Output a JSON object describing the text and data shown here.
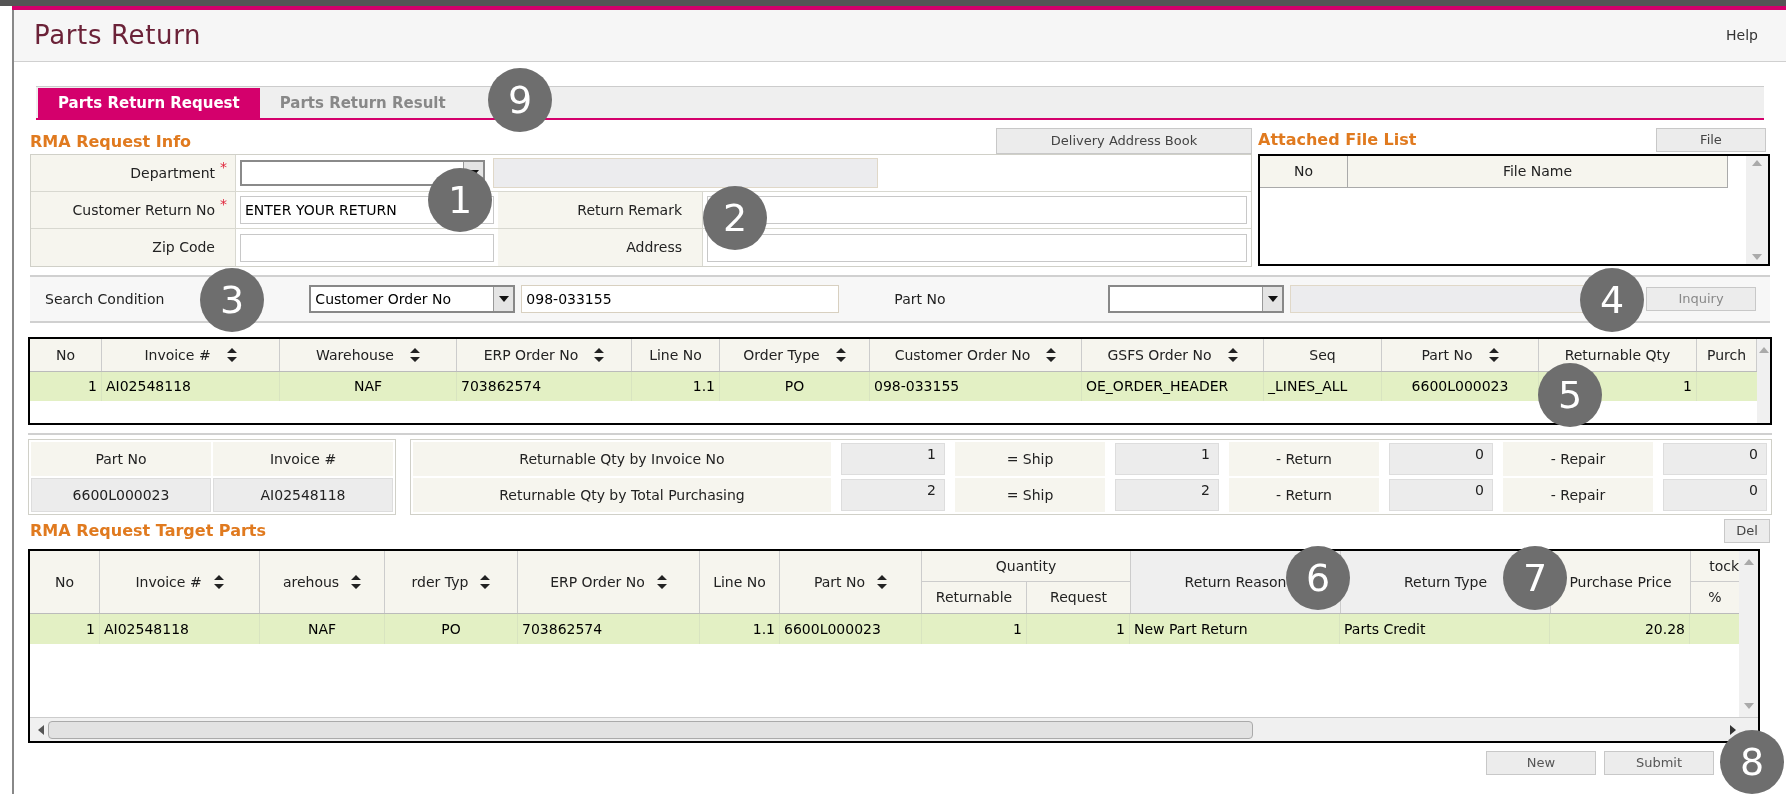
{
  "title": "Parts Return",
  "help": "Help",
  "tabs": [
    {
      "label": "Parts Return Request",
      "selected": true
    },
    {
      "label": "Parts Return Result",
      "selected": false
    }
  ],
  "request_info": {
    "heading": "RMA Request Info",
    "address_book_button": "Delivery Address Book",
    "rows": [
      [
        {
          "label": "Department",
          "marker": "*",
          "kind": "select"
        }
      ],
      [
        {
          "label": "Customer Return No",
          "marker": "*",
          "kind": "text",
          "value": "ENTER YOUR RETURN"
        },
        {
          "label": "Return Remark",
          "kind": "text"
        }
      ],
      [
        {
          "label": "Zip Code",
          "kind": "text"
        },
        {
          "label": "Address",
          "kind": "text"
        }
      ]
    ]
  },
  "attachments": {
    "heading": "Attached File List",
    "button": "File",
    "columns": [
      "No",
      "File Name"
    ]
  },
  "search": {
    "label": "Search Condition",
    "condition": "Customer Order No",
    "value": "098-033155",
    "part_label": "Part No",
    "button": "Inquiry"
  },
  "result_grid": {
    "columns": [
      {
        "label": "No",
        "sortable": false
      },
      {
        "label": "Invoice #",
        "sortable": true
      },
      {
        "label": "Warehouse",
        "sortable": true
      },
      {
        "label": "ERP Order No",
        "sortable": true
      },
      {
        "label": "Line No",
        "sortable": false
      },
      {
        "label": "Order Type",
        "sortable": true
      },
      {
        "label": "Customer Order No",
        "sortable": true
      },
      {
        "label": "GSFS Order No",
        "sortable": true
      },
      {
        "label": "Seq",
        "sortable": false
      },
      {
        "label": "Part No",
        "sortable": true
      },
      {
        "label": "Returnable Qty",
        "sortable": false
      },
      {
        "label": "Purch",
        "sortable": false
      }
    ],
    "rows": [
      {
        "selected": true,
        "cells": [
          "1",
          "AI02548118",
          "NAF",
          "703862574",
          "1.1",
          "PO",
          "098-033155",
          "OE_ORDER_HEADER",
          "_LINES_ALL",
          "6600L000023",
          "1"
        ]
      }
    ]
  },
  "part_info": {
    "columns": [
      "Part No",
      "Invoice #"
    ],
    "values": [
      "6600L000023",
      "AI02548118"
    ]
  },
  "qty_summary": {
    "rows": [
      {
        "label": "Returnable Qty by Invoice No",
        "total": "1",
        "ship_label": "= Ship",
        "ship": "1",
        "return_label": "- Return",
        "return": "0",
        "repair_label": "- Repair",
        "repair": "0"
      },
      {
        "label": "Returnable Qty by Total Purchasing",
        "total": "2",
        "ship_label": "= Ship",
        "ship": "2",
        "return_label": "- Return",
        "return": "0",
        "repair_label": "- Repair",
        "repair": "0"
      }
    ]
  },
  "target_parts": {
    "heading": "RMA Request Target Parts",
    "delete_button": "Del",
    "group_label": "Quantity",
    "columns": [
      {
        "label": "No",
        "sortable": false
      },
      {
        "label": "Invoice #",
        "sortable": true
      },
      {
        "label": "arehous",
        "sortable": true
      },
      {
        "label": "rder Typ",
        "sortable": true
      },
      {
        "label": "ERP Order No",
        "sortable": true
      },
      {
        "label": "Line No",
        "sortable": false
      },
      {
        "label": "Part No",
        "sortable": true
      },
      {
        "label": "Returnable",
        "in_group": true
      },
      {
        "label": "Request",
        "in_group": true
      },
      {
        "label": "Return Reason",
        "sortable": false
      },
      {
        "label": "Return Type",
        "sortable": false
      },
      {
        "label": "Purchase Price",
        "sortable": false
      },
      {
        "label": "tock",
        "sub": "%"
      }
    ],
    "rows": [
      {
        "selected": true,
        "cells": [
          "1",
          "AI02548118",
          "NAF",
          "PO",
          "703862574",
          "1.1",
          "6600L000023",
          "1",
          "1",
          "New Part Return",
          "Parts Credit",
          "20.28"
        ]
      }
    ]
  },
  "buttons": [
    "New",
    "Submit"
  ],
  "callouts": [
    "9",
    "1",
    "2",
    "3",
    "4",
    "5",
    "6",
    "7",
    "8"
  ]
}
